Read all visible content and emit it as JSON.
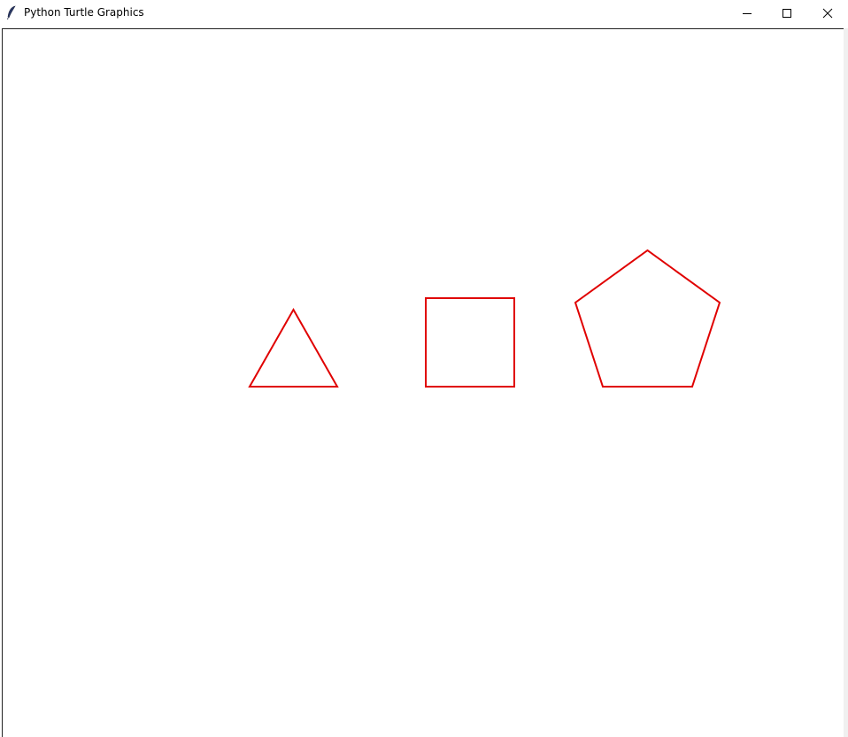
{
  "window": {
    "title": "Python Turtle Graphics",
    "icon": "feather-icon",
    "controls": {
      "minimize": "minimize-icon",
      "maximize": "maximize-icon",
      "close": "close-icon"
    }
  },
  "canvas": {
    "background": "#ffffff",
    "pen_color": "#e00000",
    "shapes": [
      {
        "name": "triangle",
        "sides": 3
      },
      {
        "name": "square",
        "sides": 4
      },
      {
        "name": "pentagon",
        "sides": 5
      }
    ]
  }
}
